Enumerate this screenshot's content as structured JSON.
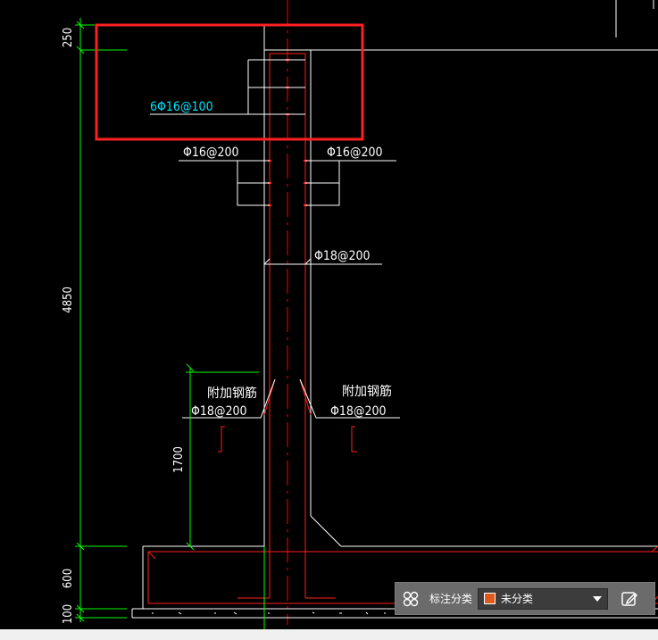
{
  "dimensions": {
    "d250": "250",
    "d4850": "4850",
    "d1700": "1700",
    "d600": "600",
    "d100": "100"
  },
  "rebar": {
    "top": "6Φ16@100",
    "left_mid": "Φ16@200",
    "right_mid": "Φ16@200",
    "wall_vertical": "Φ18@200",
    "left_extra_title": "附加钢筋",
    "left_extra_spec": "Φ18@200",
    "right_extra_title": "附加钢筋",
    "right_extra_spec": "Φ18@200"
  },
  "colors": {
    "background": "#000000",
    "dimension": "#00ff00",
    "outline": "#ffffff",
    "rebar": "#ff2020",
    "highlight_box": "#ff2020",
    "label_cyan": "#00e5ff",
    "axis": "#ff0000"
  },
  "toolbar": {
    "grid_icon": "grid-icon",
    "label": "标注分类",
    "select_value": "未分类",
    "swatch_color": "#e05a1c",
    "edit_icon": "edit-icon"
  }
}
